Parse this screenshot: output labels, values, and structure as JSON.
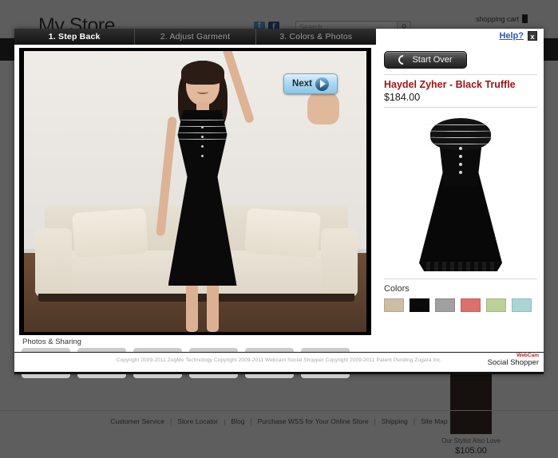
{
  "store": {
    "logo": "My Store",
    "search_placeholder": "Search",
    "search_icon": "magnifier-icon",
    "search_value": "",
    "cart_label": "shopping cart",
    "social": [
      {
        "name": "twitter-icon",
        "glyph": "t"
      },
      {
        "name": "facebook-icon",
        "glyph": "f"
      }
    ],
    "footer_links": [
      "Customer Service",
      "Store Locator",
      "Blog",
      "Purchase WSS for Your Online Store",
      "Shipping",
      "Site Map"
    ],
    "footer_separator": "|",
    "related_product": {
      "caption": "Our Stylist Also Love",
      "price": "$105.00"
    }
  },
  "wss": {
    "tabs": [
      {
        "label": "1. Step Back",
        "active": true
      },
      {
        "label": "2. Adjust Garment",
        "active": false
      },
      {
        "label": "3. Colors & Photos",
        "active": false
      }
    ],
    "help_label": "Help?",
    "close_label": "x",
    "next_label": "Next",
    "start_over_label": "Start Over",
    "photos_title": "Photos & Sharing",
    "thumbnails": [
      "",
      "",
      "",
      "",
      "",
      ""
    ],
    "product": {
      "title": "Haydel Zyher - Black Truffle",
      "price": "$184.00",
      "title_color": "#9e1313"
    },
    "colors_label": "Colors",
    "colors": [
      {
        "name": "beige",
        "hex": "#cdbda4"
      },
      {
        "name": "black",
        "hex": "#0a0a0a"
      },
      {
        "name": "gray",
        "hex": "#a0a0a0"
      },
      {
        "name": "coral",
        "hex": "#dd7068"
      },
      {
        "name": "light-green",
        "hex": "#bcd196"
      },
      {
        "name": "light-blue",
        "hex": "#a9d5d5"
      }
    ],
    "copyright": "Copyright 2009-2011 ZugMo Technology Copyright 2009-2011 Webcam Social Shopper Copyright 2009-2011 Patent Pending Zugara Inc.",
    "logo_top": "WebCam",
    "logo_bottom": "Social Shopper"
  }
}
